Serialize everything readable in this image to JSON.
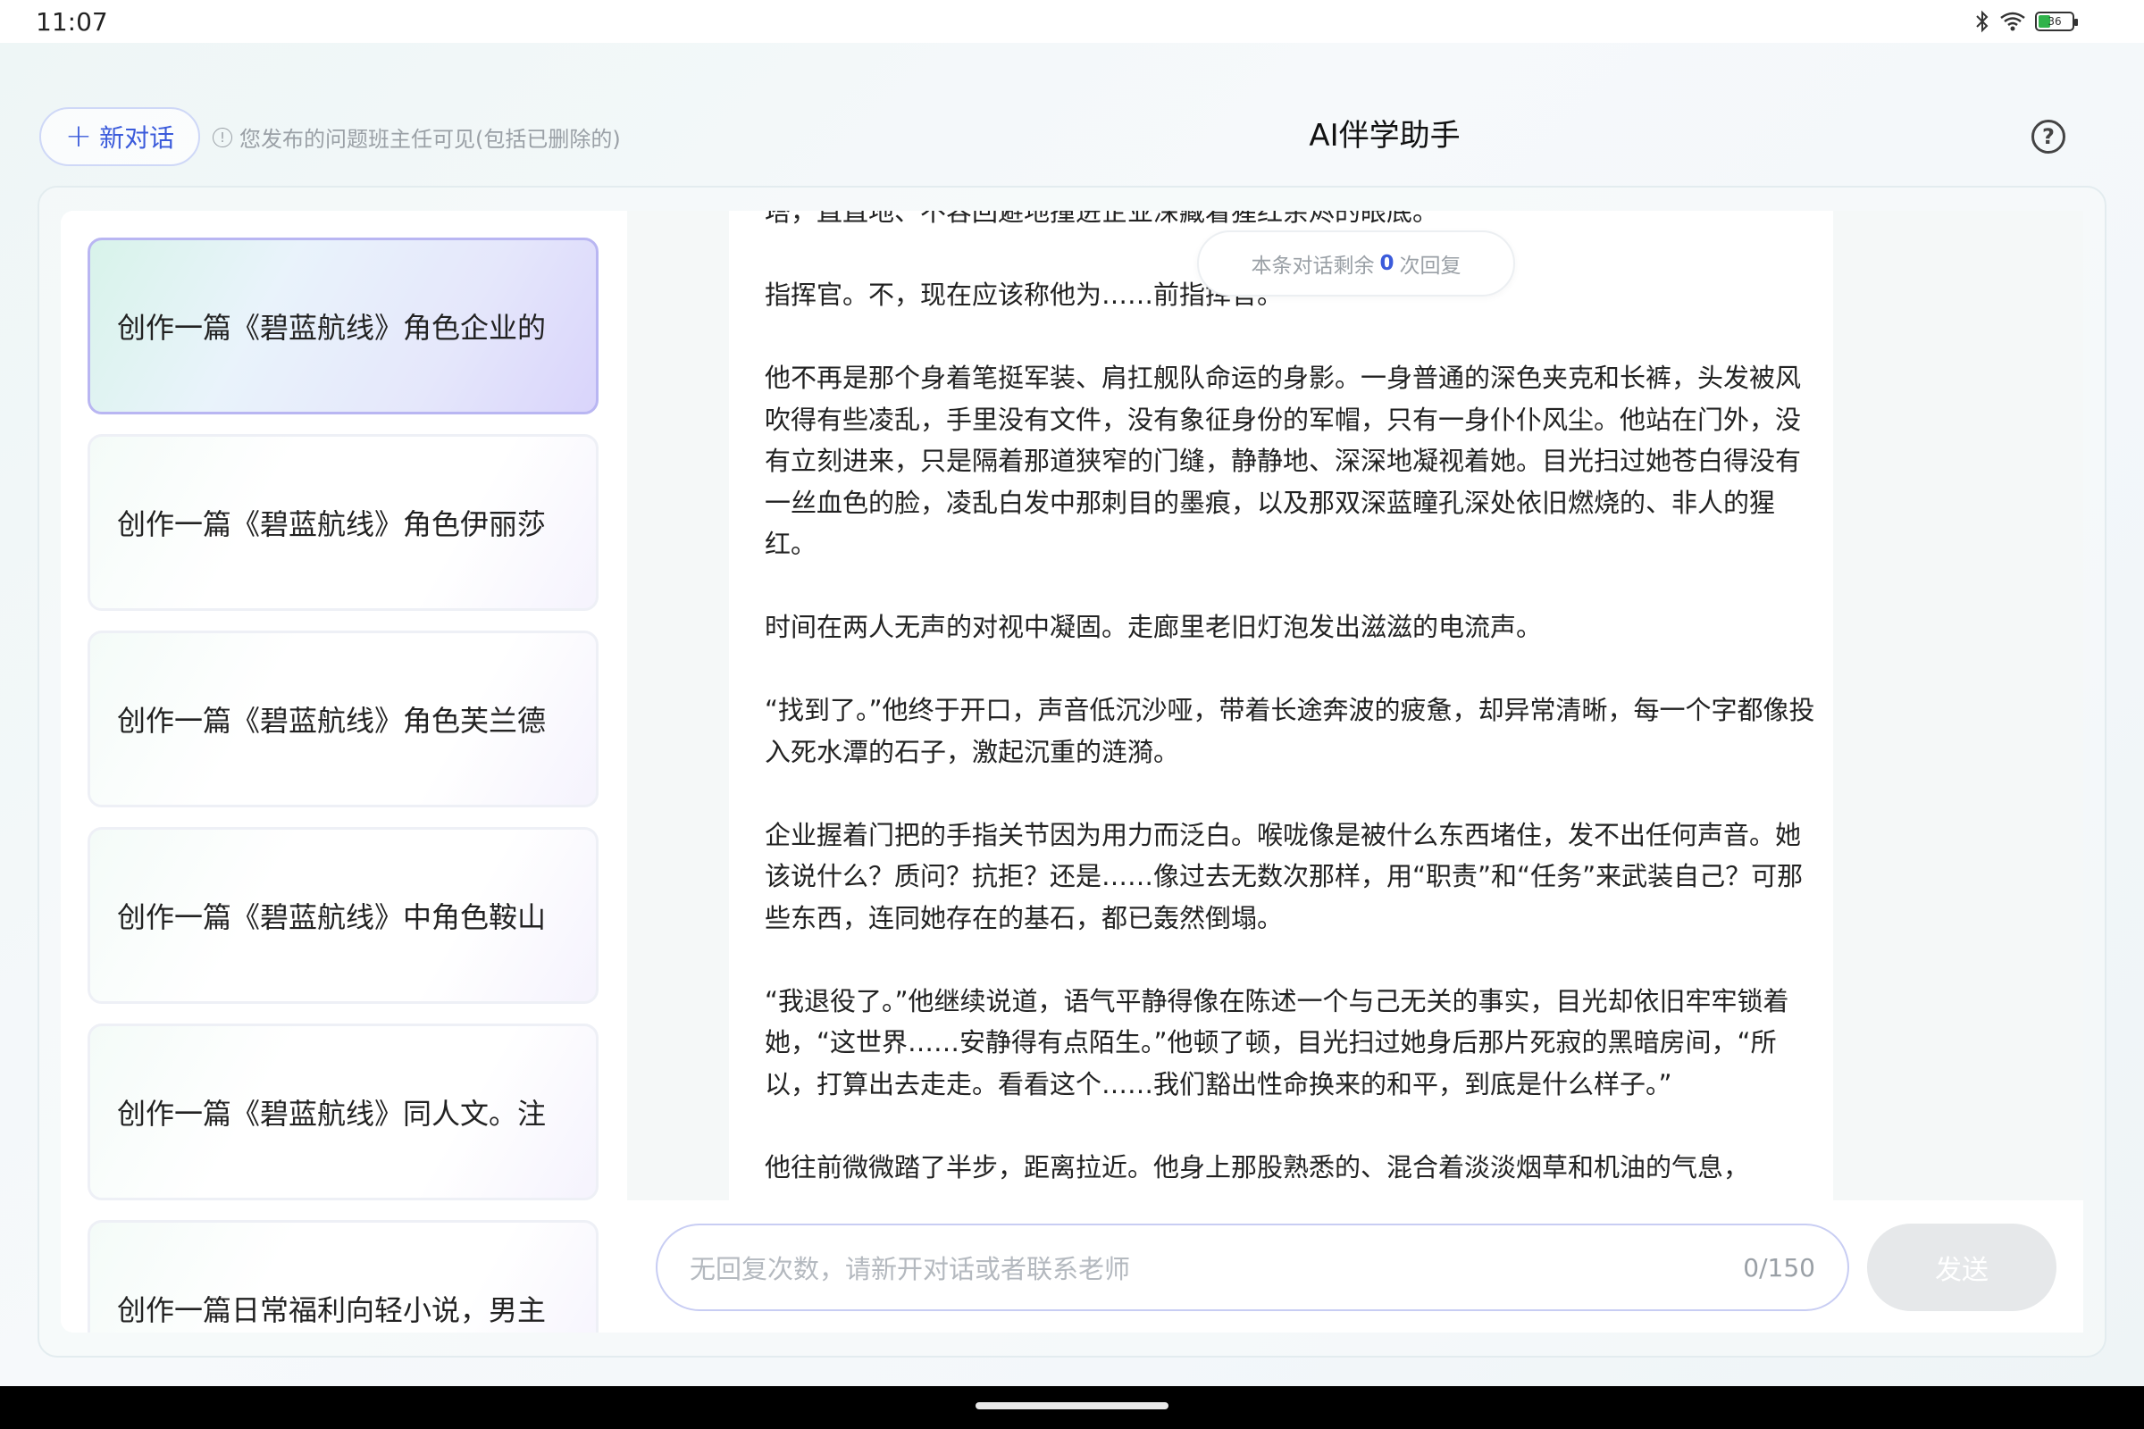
{
  "status_bar": {
    "time": "11:07",
    "battery_level": "36"
  },
  "header": {
    "new_chat_label": "新对话",
    "notice": "您发布的问题班主任可见(包括已删除的)",
    "title": "AI伴学助手",
    "help_icon": "?"
  },
  "sidebar": {
    "items": [
      {
        "label": "创作一篇《碧蓝航线》角色企业的",
        "active": true
      },
      {
        "label": "创作一篇《碧蓝航线》角色伊丽莎",
        "active": false
      },
      {
        "label": "创作一篇《碧蓝航线》角色芙兰德",
        "active": false
      },
      {
        "label": "创作一篇《碧蓝航线》中角色鞍山",
        "active": false
      },
      {
        "label": "创作一篇《碧蓝航线》同人文。注",
        "active": false
      },
      {
        "label": "创作一篇日常福利向轻小说，男主",
        "active": false
      }
    ]
  },
  "chat": {
    "remaining_prefix": "本条对话剩余",
    "remaining_count": "0",
    "remaining_suffix": "次回复",
    "paragraphs": [
      "塔，直直地、不容回避地撞进企业深藏着猩红余烬的眼底。",
      "指挥官。不，现在应该称他为……前指挥官。",
      "他不再是那个身着笔挺军装、肩扛舰队命运的身影。一身普通的深色夹克和长裤，头发被风吹得有些凌乱，手里没有文件，没有象征身份的军帽，只有一身仆仆风尘。他站在门外，没有立刻进来，只是隔着那道狭窄的门缝，静静地、深深地凝视着她。目光扫过她苍白得没有一丝血色的脸，凌乱白发中那刺目的墨痕，以及那双深蓝瞳孔深处依旧燃烧的、非人的猩红。",
      "时间在两人无声的对视中凝固。走廊里老旧灯泡发出滋滋的电流声。",
      "“找到了。”他终于开口，声音低沉沙哑，带着长途奔波的疲惫，却异常清晰，每一个字都像投入死水潭的石子，激起沉重的涟漪。",
      "企业握着门把的手指关节因为用力而泛白。喉咙像是被什么东西堵住，发不出任何声音。她该说什么？质问？抗拒？还是……像过去无数次那样，用“职责”和“任务”来武装自己？可那些东西，连同她存在的基石，都已轰然倒塌。",
      "“我退役了。”他继续说道，语气平静得像在陈述一个与己无关的事实，目光却依旧牢牢锁着她，“这世界……安静得有点陌生。”他顿了顿，目光扫过她身后那片死寂的黑暗房间，“所以，打算出去走走。看看这个……我们豁出性命换来的和平，到底是什么样子。”",
      "他往前微微踏了半步，距离拉近。他身上那股熟悉的、混合着淡淡烟草和机油的气息，"
    ]
  },
  "input": {
    "placeholder": "无回复次数，请新开对话或者联系老师",
    "char_count": "0/150",
    "send_label": "发送"
  },
  "colors": {
    "accent": "#3b5bdb",
    "active_border": "#b9b6f2",
    "input_border": "#c8cdf3",
    "send_disabled": "#e6e8ea"
  },
  "icons": {
    "bluetooth": "bluetooth-icon",
    "wifi": "wifi-icon",
    "battery": "battery-icon",
    "info": "info-icon",
    "help": "help-icon",
    "plus": "plus-icon"
  }
}
